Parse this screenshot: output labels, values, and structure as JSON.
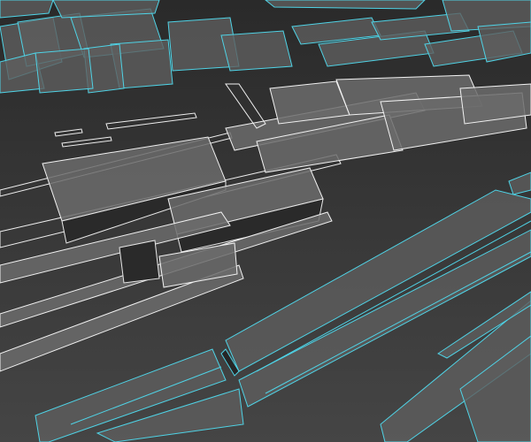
{
  "scene": {
    "description_type": "3d-wireframe-render",
    "colors": {
      "background_top": "#2a2a2a",
      "background_bottom": "#454545",
      "edge_white": "#f2f2f2",
      "edge_cyan": "#4fd3e6",
      "face_gray": "#6b6b6b"
    }
  }
}
